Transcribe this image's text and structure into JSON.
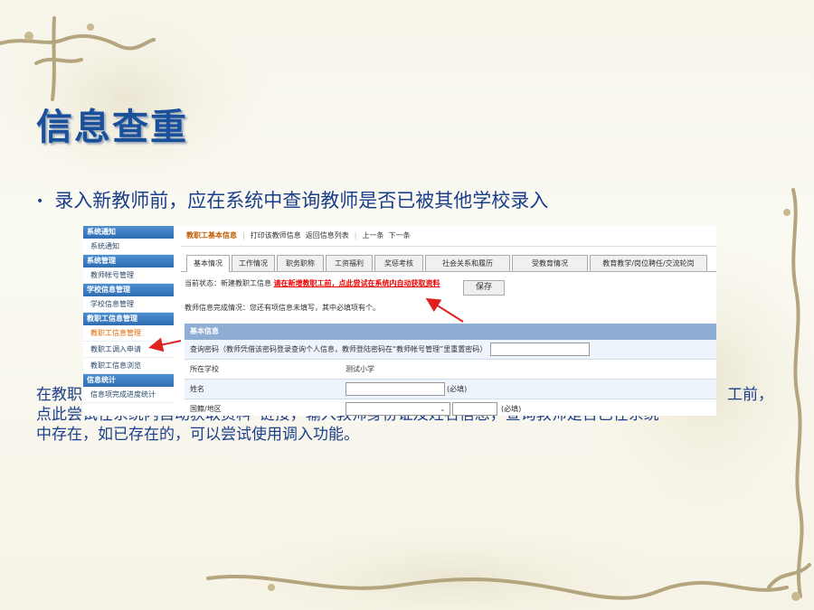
{
  "slide": {
    "title": "信息查重",
    "bullet_marker": "•",
    "bullet": "录入新教师前，应在系统中查询教师是否已被其他学校录入",
    "para_line1_left": "在教职",
    "para_line1_right": "工前，",
    "para_line2": "点此尝试在系统内自动获取资料”链接，输入教师身份证及姓名信息，查询教师是否已在系统",
    "para_line3": "中存在，如已存在的，可以尝试使用调入功能。"
  },
  "sidebar": {
    "groups": [
      {
        "head": "系统通知",
        "items": [
          "系统通知"
        ]
      },
      {
        "head": "系统管理",
        "items": [
          "教师帐号管理"
        ]
      },
      {
        "head": "学校信息管理",
        "items": [
          "学校信息管理"
        ]
      },
      {
        "head": "教职工信息管理",
        "items": [
          "教职工信息管理",
          "教职工调入申请",
          "教职工信息浏览"
        ]
      },
      {
        "head": "信息统计",
        "items": [
          "信息项完成进度统计"
        ]
      }
    ]
  },
  "toolbar": {
    "selected": "教职工基本信息",
    "print": "打印该教师信息",
    "back": "返回信息列表",
    "prev": "上一条",
    "next": "下一条"
  },
  "tabs": [
    "基本情况",
    "工作情况",
    "职务职称",
    "工资福利",
    "奖惩考核",
    "社会关系和履历",
    "受教育情况",
    "教育教学/岗位聘任/交流轮岗"
  ],
  "status": {
    "prefix": "当前状态：新建教职工信息",
    "link": "请在新增教职工前，点此尝试在系统内自动获取资料",
    "save": "保存",
    "completion": "教师信息完成情况：您还有项信息未填写，其中必填项有个。"
  },
  "form": {
    "head": "基本信息",
    "password_label": "查询密码（教师凭借该密码登录查询个人信息，教师登陆密码在“教师帐号管理”里重置密码）",
    "school_label": "所在学校",
    "school_value": "测试小学",
    "name_label": "姓名",
    "name_required": "(必填)",
    "country_label": "国籍/地区",
    "country_required": "(必填)"
  }
}
